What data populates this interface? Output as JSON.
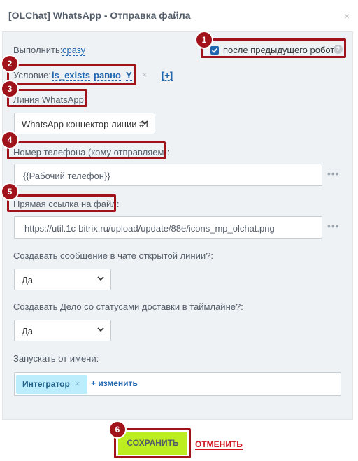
{
  "window": {
    "title": "[OLChat] WhatsApp - Отправка файла",
    "close_glyph": "×"
  },
  "execute": {
    "label": "Выполнить:",
    "value": "сразу"
  },
  "after_previous": {
    "label": "после предыдущего робота",
    "checked": true,
    "help_glyph": "?"
  },
  "condition": {
    "label": "Условие:",
    "field": "is_exists",
    "operator": "равно",
    "value": "Y",
    "remove_glyph": "×",
    "add_label": "[+]"
  },
  "whatsapp_line": {
    "label": "Линия WhatsApp:",
    "selected": "WhatsApp коннектор линии #1"
  },
  "phone": {
    "label": "Номер телефона (кому отправляем):",
    "value": "{{Рабочий телефон}}"
  },
  "file_link": {
    "label": "Прямая ссылка на файл:",
    "value": "https://util.1c-bitrix.ru/upload/update/88e/icons_mp_olchat.png"
  },
  "create_message": {
    "label": "Создавать сообщение в чате открытой линии?:",
    "selected": "Да"
  },
  "create_task": {
    "label": "Создавать Дело со статусами доставки в таймлайне?:",
    "selected": "Да"
  },
  "run_as": {
    "label": "Запускать от имени:",
    "tag": "Интегратор",
    "tag_remove_glyph": "×",
    "change_label": "+ изменить"
  },
  "footer": {
    "save_label": "СОХРАНИТЬ",
    "cancel_label": "ОТМЕНИТЬ"
  },
  "callouts": [
    "1",
    "2",
    "3",
    "4",
    "5",
    "6"
  ],
  "colors": {
    "callout": "#a1131a",
    "save_button": "#bbed21",
    "cancel_text": "#d0161f",
    "link": "#2067b0",
    "tag": "#bcedfc",
    "panel": "#eef2f4"
  },
  "icons": {
    "more": "more-dots-icon",
    "chevron": "chevron-down-icon",
    "help": "help-icon",
    "close": "close-icon"
  }
}
